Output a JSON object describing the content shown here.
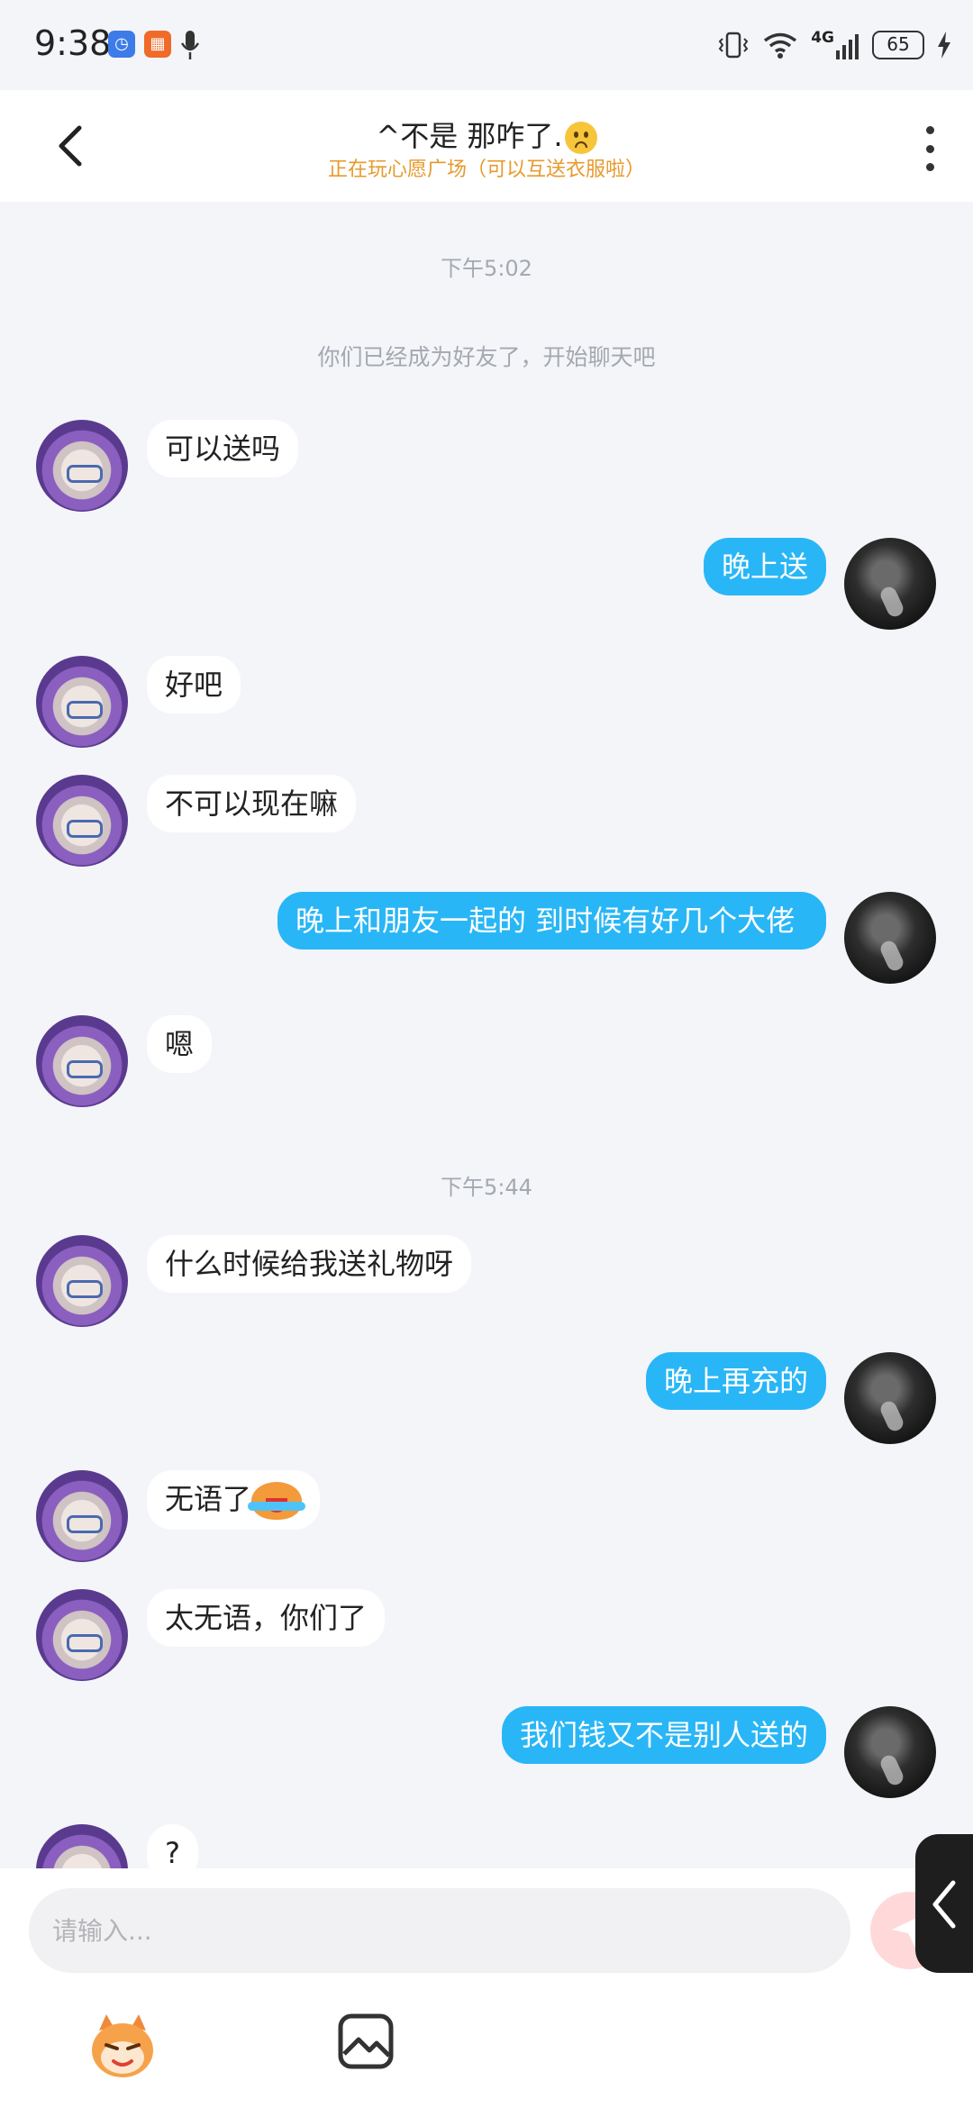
{
  "status_bar": {
    "time": "9:38",
    "network": "4G",
    "battery": "65"
  },
  "header": {
    "title": "^不是  那咋了.",
    "title_emoji": "worried-face-icon",
    "subtitle": "正在玩心愿广场（可以互送衣服啦）"
  },
  "chat": {
    "divider_1": "下午5:02",
    "system_note": "你们已经成为好友了，开始聊天吧",
    "divider_2": "下午5:44",
    "messages": [
      {
        "from": "them",
        "text": "可以送吗"
      },
      {
        "from": "me",
        "text": "晚上送"
      },
      {
        "from": "them",
        "text": "好吧"
      },
      {
        "from": "them",
        "text": "不可以现在嘛"
      },
      {
        "from": "me",
        "text": "晚上和朋友一起的 到时候有好几个大佬"
      },
      {
        "from": "them",
        "text": "嗯"
      },
      {
        "from": "them",
        "text": "什么时候给我送礼物呀"
      },
      {
        "from": "me",
        "text": "晚上再充的"
      },
      {
        "from": "them",
        "text": "无语了"
      },
      {
        "from": "them",
        "text": "太无语，你们了"
      },
      {
        "from": "me",
        "text": "我们钱又不是别人送的"
      },
      {
        "from": "them",
        "text": "?"
      }
    ]
  },
  "input": {
    "placeholder": "请输入..."
  },
  "colors": {
    "outgoing_bubble": "#29b6f6",
    "subtitle": "#e69a2c",
    "background": "#f4f5f9"
  }
}
